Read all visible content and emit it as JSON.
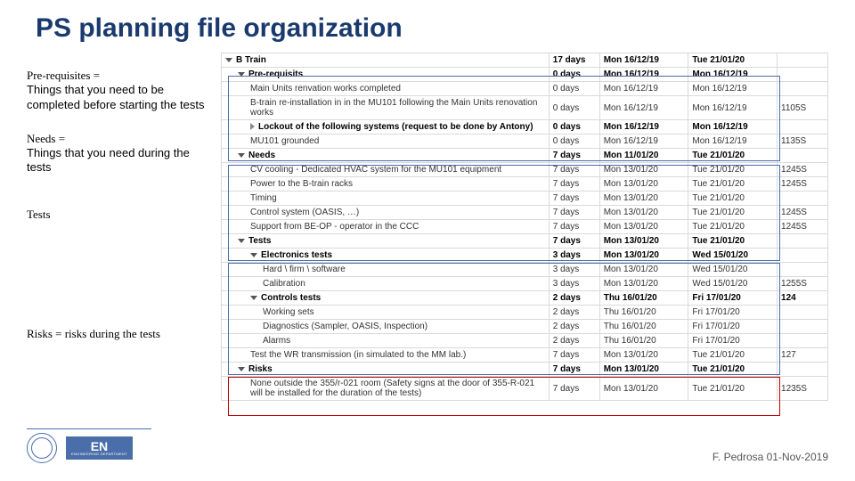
{
  "title": "PS planning file organization",
  "notes": {
    "prereq_hd": "Pre-requisites =",
    "prereq_body": "Things that you need to be completed before starting the tests",
    "needs_hd": "Needs =",
    "needs_body": "Things that you need during the tests",
    "tests_hd": "Tests",
    "risks_hd": "Risks = risks during the tests"
  },
  "rows": [
    {
      "indent": 0,
      "exp": "open",
      "bold": true,
      "task": "B Train",
      "dur": "17 days",
      "start": "Mon 16/12/19",
      "end": "Tue 21/01/20",
      "room": ""
    },
    {
      "indent": 1,
      "exp": "open",
      "bold": true,
      "task": "Pre-requisits",
      "dur": "0 days",
      "start": "Mon 16/12/19",
      "end": "Mon 16/12/19",
      "room": ""
    },
    {
      "indent": 2,
      "exp": "",
      "bold": false,
      "task": "Main Units renvation works completed",
      "dur": "0 days",
      "start": "Mon 16/12/19",
      "end": "Mon 16/12/19",
      "room": ""
    },
    {
      "indent": 2,
      "exp": "",
      "bold": false,
      "task": "B-train re-installation in in the MU101 following the Main Units renovation works",
      "dur": "0 days",
      "start": "Mon 16/12/19",
      "end": "Mon 16/12/19",
      "room": "1105S"
    },
    {
      "indent": 2,
      "exp": "closed",
      "bold": true,
      "task": "Lockout of the following systems (request to be done by Antony)",
      "dur": "0 days",
      "start": "Mon 16/12/19",
      "end": "Mon 16/12/19",
      "room": ""
    },
    {
      "indent": 2,
      "exp": "",
      "bold": false,
      "task": "MU101 grounded",
      "dur": "0 days",
      "start": "Mon 16/12/19",
      "end": "Mon 16/12/19",
      "room": "1135S"
    },
    {
      "indent": 1,
      "exp": "open",
      "bold": true,
      "task": "Needs",
      "dur": "7 days",
      "start": "Mon 11/01/20",
      "end": "Tue 21/01/20",
      "room": ""
    },
    {
      "indent": 2,
      "exp": "",
      "bold": false,
      "task": "CV cooling - Dedicated HVAC system for the MU101 equipment",
      "dur": "7 days",
      "start": "Mon 13/01/20",
      "end": "Tue 21/01/20",
      "room": "1245S"
    },
    {
      "indent": 2,
      "exp": "",
      "bold": false,
      "task": "Power to the B-train racks",
      "dur": "7 days",
      "start": "Mon 13/01/20",
      "end": "Tue 21/01/20",
      "room": "1245S"
    },
    {
      "indent": 2,
      "exp": "",
      "bold": false,
      "task": "Timing",
      "dur": "7 days",
      "start": "Mon 13/01/20",
      "end": "Tue 21/01/20",
      "room": ""
    },
    {
      "indent": 2,
      "exp": "",
      "bold": false,
      "task": "Control system (OASIS, …)",
      "dur": "7 days",
      "start": "Mon 13/01/20",
      "end": "Tue 21/01/20",
      "room": "1245S"
    },
    {
      "indent": 2,
      "exp": "",
      "bold": false,
      "task": "Support from BE-OP - operator in the CCC",
      "dur": "7 days",
      "start": "Mon 13/01/20",
      "end": "Tue 21/01/20",
      "room": "1245S"
    },
    {
      "indent": 1,
      "exp": "open",
      "bold": true,
      "task": "Tests",
      "dur": "7 days",
      "start": "Mon 13/01/20",
      "end": "Tue 21/01/20",
      "room": ""
    },
    {
      "indent": 2,
      "exp": "open",
      "bold": true,
      "task": "Electronics tests",
      "dur": "3 days",
      "start": "Mon 13/01/20",
      "end": "Wed 15/01/20",
      "room": ""
    },
    {
      "indent": 3,
      "exp": "",
      "bold": false,
      "task": "Hard \\ firm \\ software",
      "dur": "3 days",
      "start": "Mon 13/01/20",
      "end": "Wed 15/01/20",
      "room": ""
    },
    {
      "indent": 3,
      "exp": "",
      "bold": false,
      "task": "Calibration",
      "dur": "3 days",
      "start": "Mon 13/01/20",
      "end": "Wed 15/01/20",
      "room": "1255S"
    },
    {
      "indent": 2,
      "exp": "open",
      "bold": true,
      "task": "Controls tests",
      "dur": "2 days",
      "start": "Thu 16/01/20",
      "end": "Fri 17/01/20",
      "room": "124"
    },
    {
      "indent": 3,
      "exp": "",
      "bold": false,
      "task": "Working sets",
      "dur": "2 days",
      "start": "Thu 16/01/20",
      "end": "Fri 17/01/20",
      "room": ""
    },
    {
      "indent": 3,
      "exp": "",
      "bold": false,
      "task": "Diagnostics (Sampler, OASIS, Inspection)",
      "dur": "2 days",
      "start": "Thu 16/01/20",
      "end": "Fri 17/01/20",
      "room": ""
    },
    {
      "indent": 3,
      "exp": "",
      "bold": false,
      "task": "Alarms",
      "dur": "2 days",
      "start": "Thu 16/01/20",
      "end": "Fri 17/01/20",
      "room": ""
    },
    {
      "indent": 2,
      "exp": "",
      "bold": false,
      "task": "Test the WR transmission (in simulated to the MM lab.)",
      "dur": "7 days",
      "start": "Mon 13/01/20",
      "end": "Tue 21/01/20",
      "room": "127"
    },
    {
      "indent": 1,
      "exp": "open",
      "bold": true,
      "task": "Risks",
      "dur": "7 days",
      "start": "Mon 13/01/20",
      "end": "Tue 21/01/20",
      "room": ""
    },
    {
      "indent": 2,
      "exp": "",
      "bold": false,
      "task": "None outside the 355/r-021 room (Safety signs at the door of 355-R-021 will be installed for the duration of the tests)",
      "dur": "7 days",
      "start": "Mon 13/01/20",
      "end": "Tue 21/01/20",
      "room": "1235S"
    }
  ],
  "logos": {
    "en_big": "EN",
    "en_small": "ENGINEERING DEPARTMENT"
  },
  "footer_right": "F. Pedrosa 01-Nov-2019"
}
